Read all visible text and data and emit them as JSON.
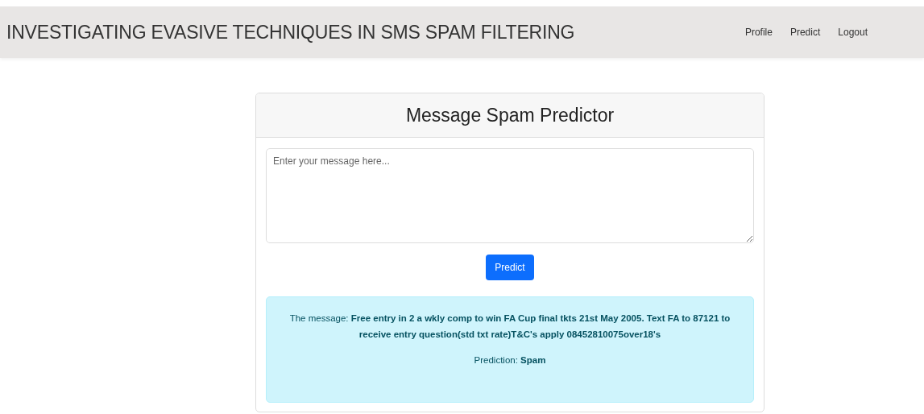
{
  "navbar": {
    "title": "INVESTIGATING EVASIVE TECHNIQUES IN SMS SPAM FILTERING",
    "links": [
      {
        "label": "Profile"
      },
      {
        "label": "Predict"
      },
      {
        "label": "Logout"
      }
    ]
  },
  "card": {
    "title": "Message Spam Predictor",
    "message_field": {
      "placeholder": "Enter your message here..."
    },
    "button": "Predict",
    "result": {
      "message": "The message: **Free entry in 2 a wkly comp to win FA Cup final tkts 21st May 2005. Text FA to 87121 to receive entry question(std txt rate)T&C's apply 08452810075over18's**",
      "prediction": "Prediction: **Spam**"
    }
  }
}
